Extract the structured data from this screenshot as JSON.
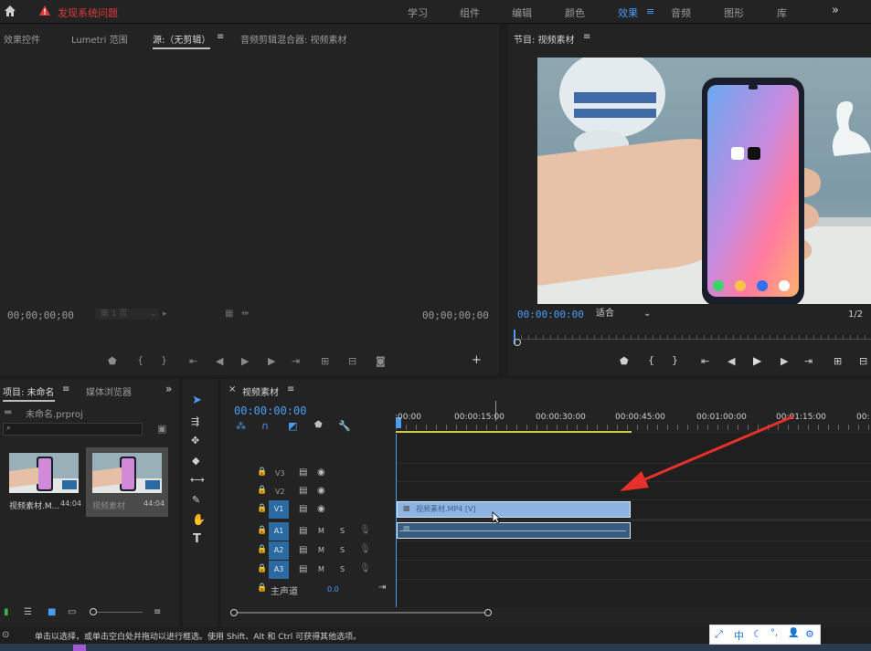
{
  "topbar": {
    "alert_text": "发现系统问题",
    "workspaces": [
      "学习",
      "组件",
      "编辑",
      "颜色",
      "效果",
      "音频",
      "图形",
      "库"
    ],
    "active_workspace": "效果",
    "overflow": "»"
  },
  "source_panel": {
    "tabs": [
      "效果控件",
      "Lumetri 范围",
      "源:（无剪辑）",
      "音频剪辑混合器: 视频素材"
    ],
    "timecode_left": "00;00;00;00",
    "page_select": "第 1 页",
    "timecode_right": "00;00;00;00"
  },
  "program_panel": {
    "title": "节目: 视频素材",
    "timecode": "00:00:00:00",
    "fit_select": "适合",
    "fraction": "1/2"
  },
  "project_panel": {
    "tabs": [
      "项目: 未命名",
      "媒体浏览器"
    ],
    "file_name": "未命名.prproj",
    "search_placeholder": "",
    "items": [
      {
        "name": "视频素材.M...",
        "duration": "44:04"
      },
      {
        "name": "视频素材",
        "duration": "44:04"
      }
    ]
  },
  "timeline": {
    "tab_title": "视频素材",
    "timecode": "00:00:00:00",
    "ruler_labels": [
      ":00:00",
      "00:00:15:00",
      "00:00:30:00",
      "00:00:45:00",
      "00:01:00:00",
      "00:01:15:00",
      "00:"
    ],
    "video_tracks": [
      "V3",
      "V2",
      "V1"
    ],
    "audio_tracks": [
      "A1",
      "A2",
      "A3"
    ],
    "video_targets": [
      "",
      "",
      "V1"
    ],
    "audio_targets": [
      "A1",
      "A2",
      "A3"
    ],
    "master_label": "主声道",
    "master_value": "0.0",
    "clip_label": "视频素材.MP4 [V]",
    "mute_label": "M",
    "solo_label": "S"
  },
  "status_bar": {
    "text": "单击以选择，或单击空白处并拖动以进行框选。使用 Shift、Alt 和 Ctrl 可获得其他选项。"
  },
  "ime_bar": {
    "items": [
      "⤢",
      "中",
      "☾",
      "°,",
      "👤",
      "⚙"
    ]
  },
  "colors": {
    "accent_blue": "#4b9cf5",
    "clip_blue": "#8db4e2",
    "alert_red": "#e03a3a",
    "arrow_red": "#e8302a"
  }
}
